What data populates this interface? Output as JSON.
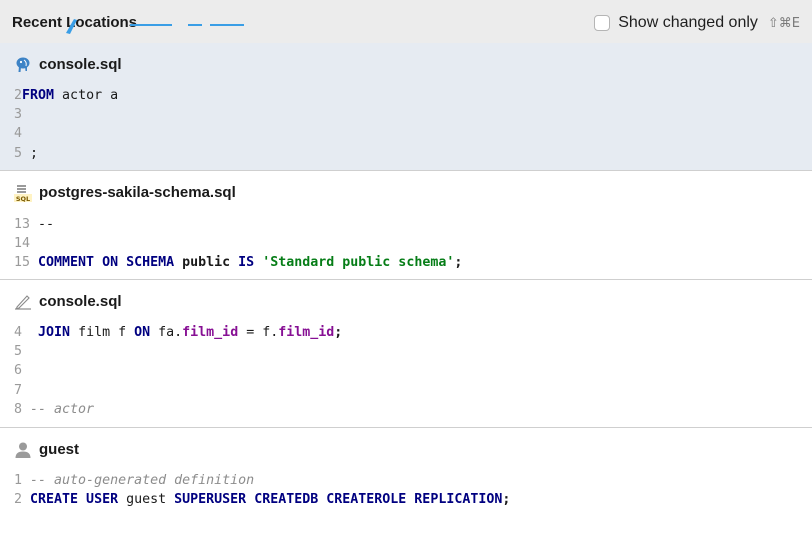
{
  "header": {
    "title": "Recent Locations",
    "show_changed_label": "Show changed only",
    "show_changed_checked": false,
    "shortcut": "⇧⌘E"
  },
  "entries": [
    {
      "title": "console.sql",
      "icon": "postgresql-elephant-icon",
      "selected": true,
      "lines": [
        {
          "num": "2",
          "tokens": [
            {
              "t": "kw",
              "v": "FROM"
            },
            {
              "t": "plain",
              "v": " actor a"
            }
          ]
        },
        {
          "num": "3",
          "tokens": []
        },
        {
          "num": "4",
          "tokens": []
        },
        {
          "num": "5",
          "tokens": [
            {
              "t": "plain",
              "v": " ;"
            }
          ]
        }
      ]
    },
    {
      "title": "postgres-sakila-schema.sql",
      "icon": "sql-file-icon",
      "selected": false,
      "lines": [
        {
          "num": "13",
          "tokens": [
            {
              "t": "cmt-plain",
              "v": " --"
            }
          ]
        },
        {
          "num": "14",
          "tokens": []
        },
        {
          "num": "15",
          "tokens": [
            {
              "t": "kw",
              "v": " COMMENT ON SCHEMA"
            },
            {
              "t": "ident-bold",
              "v": " public"
            },
            {
              "t": "kw",
              "v": " IS"
            },
            {
              "t": "plain",
              "v": " "
            },
            {
              "t": "str",
              "v": "'Standard public schema'"
            },
            {
              "t": "ident-bold",
              "v": ";"
            }
          ]
        }
      ]
    },
    {
      "title": "console.sql",
      "icon": "console-pen-icon",
      "selected": false,
      "lines": [
        {
          "num": "4",
          "tokens": [
            {
              "t": "plain",
              "v": "  "
            },
            {
              "t": "kw",
              "v": "JOIN"
            },
            {
              "t": "plain",
              "v": " film f "
            },
            {
              "t": "kw",
              "v": "ON"
            },
            {
              "t": "plain",
              "v": " fa."
            },
            {
              "t": "fld",
              "v": "film_id"
            },
            {
              "t": "plain",
              "v": " = f."
            },
            {
              "t": "fld",
              "v": "film_id"
            },
            {
              "t": "ident-bold",
              "v": ";"
            }
          ]
        },
        {
          "num": "5",
          "tokens": []
        },
        {
          "num": "6",
          "tokens": []
        },
        {
          "num": "7",
          "tokens": []
        },
        {
          "num": "8",
          "tokens": [
            {
              "t": "cmt",
              "v": " -- actor"
            }
          ]
        }
      ]
    },
    {
      "title": "guest",
      "icon": "user-icon",
      "selected": false,
      "lines": [
        {
          "num": "1",
          "tokens": [
            {
              "t": "cmt",
              "v": " -- auto-generated definition"
            }
          ]
        },
        {
          "num": "2",
          "tokens": [
            {
              "t": "kw",
              "v": " CREATE USER"
            },
            {
              "t": "plain",
              "v": " guest "
            },
            {
              "t": "kw",
              "v": "SUPERUSER CREATEDB CREATEROLE REPLICATION"
            },
            {
              "t": "ident-bold",
              "v": ";"
            }
          ]
        }
      ]
    }
  ]
}
